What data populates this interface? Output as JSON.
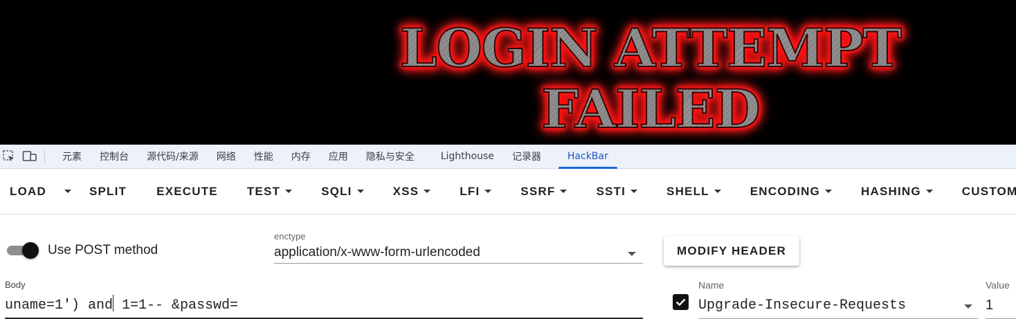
{
  "banner": {
    "line1": "LOGIN ATTEMPT",
    "line2": "FAILED"
  },
  "devtools": {
    "icons": [
      "inspect-element-icon",
      "device-toolbar-icon"
    ],
    "tabs": [
      {
        "label": "元素"
      },
      {
        "label": "控制台"
      },
      {
        "label": "源代码/来源"
      },
      {
        "label": "网络"
      },
      {
        "label": "性能"
      },
      {
        "label": "内存"
      },
      {
        "label": "应用"
      },
      {
        "label": "隐私与安全"
      },
      {
        "label": "Lighthouse"
      },
      {
        "label": "记录器"
      },
      {
        "label": "HackBar"
      }
    ],
    "active_tab": "HackBar"
  },
  "toolbar": {
    "load": "LOAD",
    "split": "SPLIT",
    "execute": "EXECUTE",
    "test": "TEST",
    "sqli": "SQLI",
    "xss": "XSS",
    "lfi": "LFI",
    "ssrf": "SSRF",
    "ssti": "SSTI",
    "shell": "SHELL",
    "encoding": "ENCODING",
    "hashing": "HASHING",
    "custom": "CUSTOM"
  },
  "request": {
    "use_post_label": "Use POST method",
    "use_post_enabled": true,
    "enctype_label": "enctype",
    "enctype_value": "application/x-www-form-urlencoded",
    "modify_header_label": "MODIFY HEADER",
    "body_label": "Body",
    "body_before_cursor": "uname=1') and",
    "body_after_cursor": " 1=1-- &passwd="
  },
  "header": {
    "enabled": true,
    "name_label": "Name",
    "name_value": "Upgrade-Insecure-Requests",
    "value_label": "Value",
    "value_value": "1"
  }
}
